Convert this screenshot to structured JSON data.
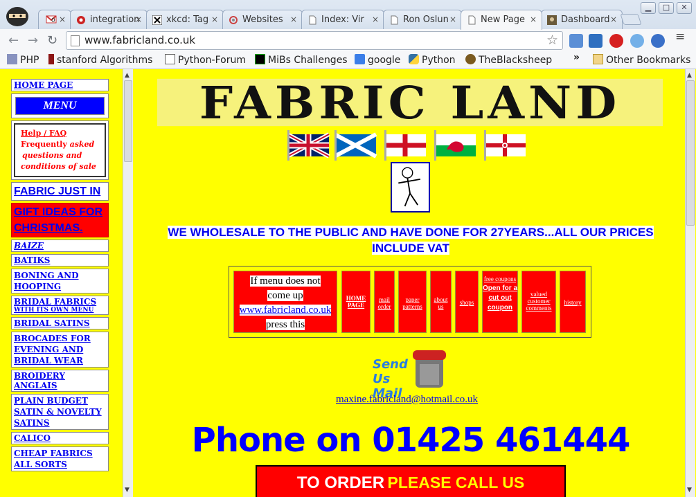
{
  "browser": {
    "tabs": [
      {
        "label": "",
        "icon": "gmail-icon"
      },
      {
        "label": "integration",
        "icon": "integration-icon"
      },
      {
        "label": "xkcd: Tag",
        "icon": "xkcd-icon"
      },
      {
        "label": "Websites",
        "icon": "websites-icon"
      },
      {
        "label": "Index: Vir",
        "icon": "page-icon"
      },
      {
        "label": "Ron Oslun",
        "icon": "page-icon"
      },
      {
        "label": "New Page",
        "icon": "page-icon"
      },
      {
        "label": "Dashboard",
        "icon": "dashboard-icon"
      }
    ],
    "gmail_count": "0",
    "close_glyph": "×",
    "url": "www.fabricland.co.uk",
    "bookmarks": [
      "PHP",
      "stanford Algorithms",
      "Python-Forum",
      "MiBs Challenges",
      "google",
      "Python",
      "TheBlacksheep"
    ],
    "other_bookmarks": "Other Bookmarks",
    "more_glyph": "»"
  },
  "sidebar": {
    "home": "HOME PAGE",
    "menu": "MENU",
    "help_title": "Help / FAQ",
    "help_line1": "Frequently",
    "help_line1b": "asked",
    "help_line2": "questions and",
    "help_line3": "conditions of sale",
    "fabric_just_in": "FABRIC JUST IN",
    "gift_ideas": "GIFT IDEAS FOR CHRISTMAS.",
    "items": [
      "BAIZE",
      "BATIKS",
      "BONING AND HOOPING",
      "BRIDAL FABRICS",
      "BRIDAL SATINS",
      "BROCADES FOR EVENING AND BRIDAL WEAR",
      "BROIDERY ANGLAIS",
      "PLAIN BUDGET SATIN & NOVELTY SATINS",
      "CALICO",
      "CHEAP FABRICS ALL SORTS"
    ],
    "bridal_sub": "WITH ITS OWN MENU"
  },
  "main": {
    "logo": "FABRIC LAND",
    "wholesale_line1": "WE WHOLESALE TO THE PUBLIC AND HAVE DONE FOR 27YEARS...ALL OUR PRICES",
    "wholesale_line2": "INCLUDE VAT",
    "menu_hint_a": "If menu does not",
    "menu_hint_b": "come up",
    "menu_hint_link": "www.fabricland.co.uk",
    "menu_hint_c": "press this",
    "nav": [
      "HOME PAGE",
      "mail order",
      "paper patterns",
      "about us",
      "shops",
      "free coupons",
      "valued customer comments",
      "history"
    ],
    "coupon_note": "Open for a cut out coupon",
    "send_mail": "Send Us Mail",
    "email": "maxine.fabricland@hotmail.co.uk",
    "phone": "Phone on 01425 461444",
    "order_a": "TO ORDER",
    "order_b": "PLEASE CALL US"
  }
}
